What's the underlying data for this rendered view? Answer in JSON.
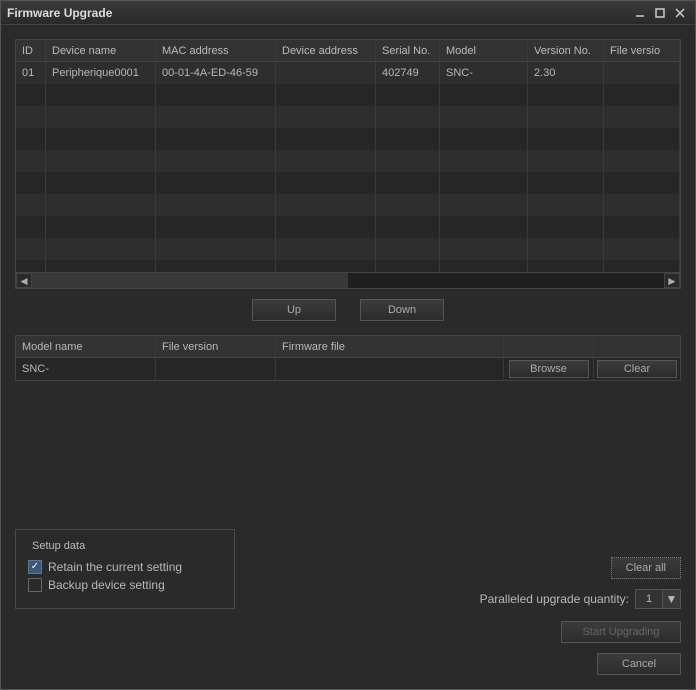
{
  "window": {
    "title": "Firmware Upgrade"
  },
  "grid": {
    "headers": {
      "id": "ID",
      "device_name": "Device name",
      "mac": "MAC address",
      "device_address": "Device address",
      "serial": "Serial No.",
      "model": "Model",
      "version": "Version No.",
      "file_version": "File versio"
    },
    "rows": [
      {
        "id": "01",
        "device_name": "Peripherique0001",
        "mac": "00-01-4A-ED-46-59",
        "device_address": "",
        "serial": "402749",
        "model": "SNC-",
        "version": "2.30",
        "file_version": ""
      }
    ]
  },
  "buttons": {
    "up": "Up",
    "down": "Down",
    "browse": "Browse",
    "clear": "Clear",
    "clear_all": "Clear all",
    "start_upgrading": "Start Upgrading",
    "cancel": "Cancel"
  },
  "fwtable": {
    "headers": {
      "model_name": "Model name",
      "file_version": "File version",
      "firmware_file": "Firmware file"
    },
    "rows": [
      {
        "model_name": "SNC-",
        "file_version": "",
        "firmware_file": ""
      }
    ]
  },
  "setup": {
    "legend": "Setup data",
    "retain_label": "Retain the current setting",
    "retain_checked": true,
    "backup_label": "Backup device setting",
    "backup_checked": false
  },
  "parallel": {
    "label": "Paralleled upgrade quantity:",
    "value": "1"
  }
}
